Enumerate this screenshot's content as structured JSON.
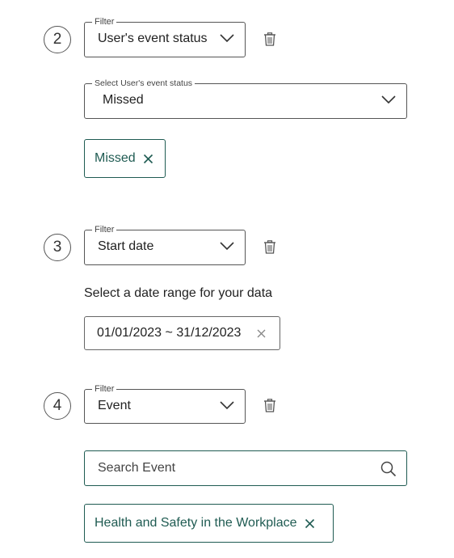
{
  "filters": [
    {
      "step": "2",
      "legend": "Filter",
      "value": "User's event status",
      "sub_select": {
        "legend": "Select User's event status",
        "value": "Missed"
      },
      "chips": [
        "Missed"
      ]
    },
    {
      "step": "3",
      "legend": "Filter",
      "value": "Start date",
      "help_text": "Select a date range for your data",
      "date_range": "01/01/2023 ~ 31/12/2023"
    },
    {
      "step": "4",
      "legend": "Filter",
      "value": "Event",
      "search": {
        "placeholder": "Search Event"
      },
      "chips": [
        "Health and Safety in the Workplace"
      ]
    }
  ],
  "colors": {
    "accent": "#1f5b52",
    "border": "#555555",
    "text": "#222222"
  },
  "icons": {
    "dropdown": "chevron-down-icon",
    "delete": "trash-icon",
    "remove": "close-icon",
    "search": "search-icon"
  }
}
